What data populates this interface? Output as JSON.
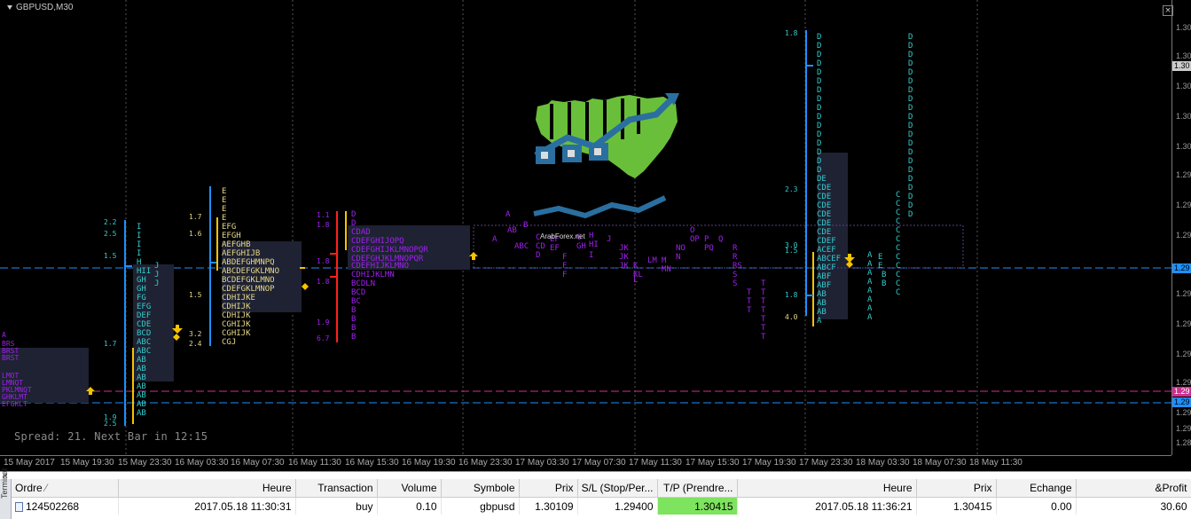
{
  "chart": {
    "title": "GBPUSD,M30",
    "spread_text": "Spread: 21. Next Bar in 12:15",
    "price_ticks": [
      "1.30",
      "1.30",
      "1.30",
      "1.30",
      "1.30",
      "1.29",
      "1.29",
      "1.29",
      "1.29",
      "1.29",
      "1.29",
      "1.29",
      "1.29",
      "1.29",
      "1.28"
    ],
    "price_tags": [
      "1.30",
      "1.29",
      "1.29",
      "1.29"
    ],
    "time_labels": [
      "15 May 2017",
      "15 May 19:30",
      "15 May 23:30",
      "16 May 03:30",
      "16 May 07:30",
      "16 May 11:30",
      "16 May 15:30",
      "16 May 19:30",
      "16 May 23:30",
      "17 May 03:30",
      "17 May 07:30",
      "17 May 11:30",
      "17 May 15:30",
      "17 May 19:30",
      "17 May 23:30",
      "18 May 03:30",
      "18 May 07:30",
      "18 May 11:30"
    ],
    "logo_text": "ArabForex.net",
    "colors": {
      "bid_line": "#1e90ff",
      "alert_line": "#cc2f8f",
      "tp_cell": "#7ee35e",
      "profile_purple": "#a020f0",
      "profile_cyan": "#33cccc",
      "profile_yellow": "#e8d888"
    }
  },
  "terminal": {
    "side_label": "Terminal",
    "columns": [
      "Ordre",
      "Heure",
      "Transaction",
      "Volume",
      "Symbole",
      "Prix",
      "S/L (Stop/Per...",
      "T/P (Prendre...",
      "Heure",
      "Prix",
      "Echange",
      "&Profit"
    ],
    "rows": [
      {
        "order": "124502268",
        "open_time": "2017.05.18 11:30:31",
        "type": "buy",
        "volume": "0.10",
        "symbol": "gbpusd",
        "open_price": "1.30109",
        "sl": "1.29400",
        "tp": "1.30415",
        "close_time": "2017.05.18 11:36:21",
        "price": "1.30415",
        "swap": "0.00",
        "profit": "30.60"
      }
    ]
  }
}
